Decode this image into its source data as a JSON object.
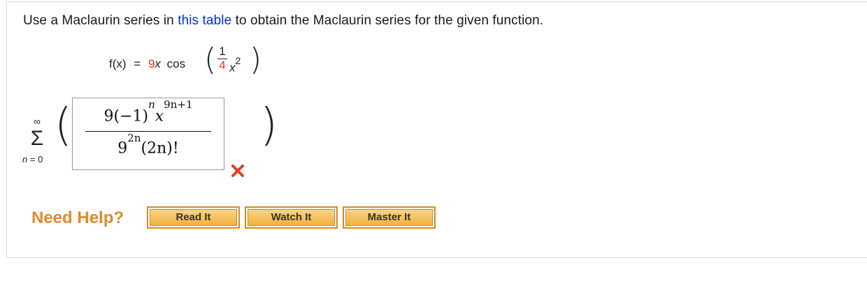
{
  "question": {
    "prompt_before": "Use a Maclaurin series in ",
    "prompt_link": "this table",
    "prompt_after": " to obtain the Maclaurin series for the given function."
  },
  "function": {
    "lhs": "f(x)",
    "equals": "=",
    "coefficient": "9",
    "var": "x",
    "func": "cos",
    "frac_num": "1",
    "frac_den": "4",
    "inner_var": "x",
    "inner_exp": "2"
  },
  "series": {
    "upper": "∞",
    "sigma": "Σ",
    "lower_var": "n",
    "lower_eq": "= 0",
    "answer_num_base": "9(−1)",
    "answer_num_exp1": "n",
    "answer_num_var": "x",
    "answer_num_exp2": "9n+1",
    "answer_den_base": "9",
    "answer_den_exp": "2n",
    "answer_den_rest": "(2n)!",
    "status": "incorrect"
  },
  "help": {
    "label": "Need Help?",
    "buttons": [
      "Read It",
      "Watch It",
      "Master It"
    ]
  },
  "colors": {
    "link": "#0033cc",
    "red": "#e8351e",
    "help": "#e08a2a",
    "wrong": "#e23b2a"
  }
}
